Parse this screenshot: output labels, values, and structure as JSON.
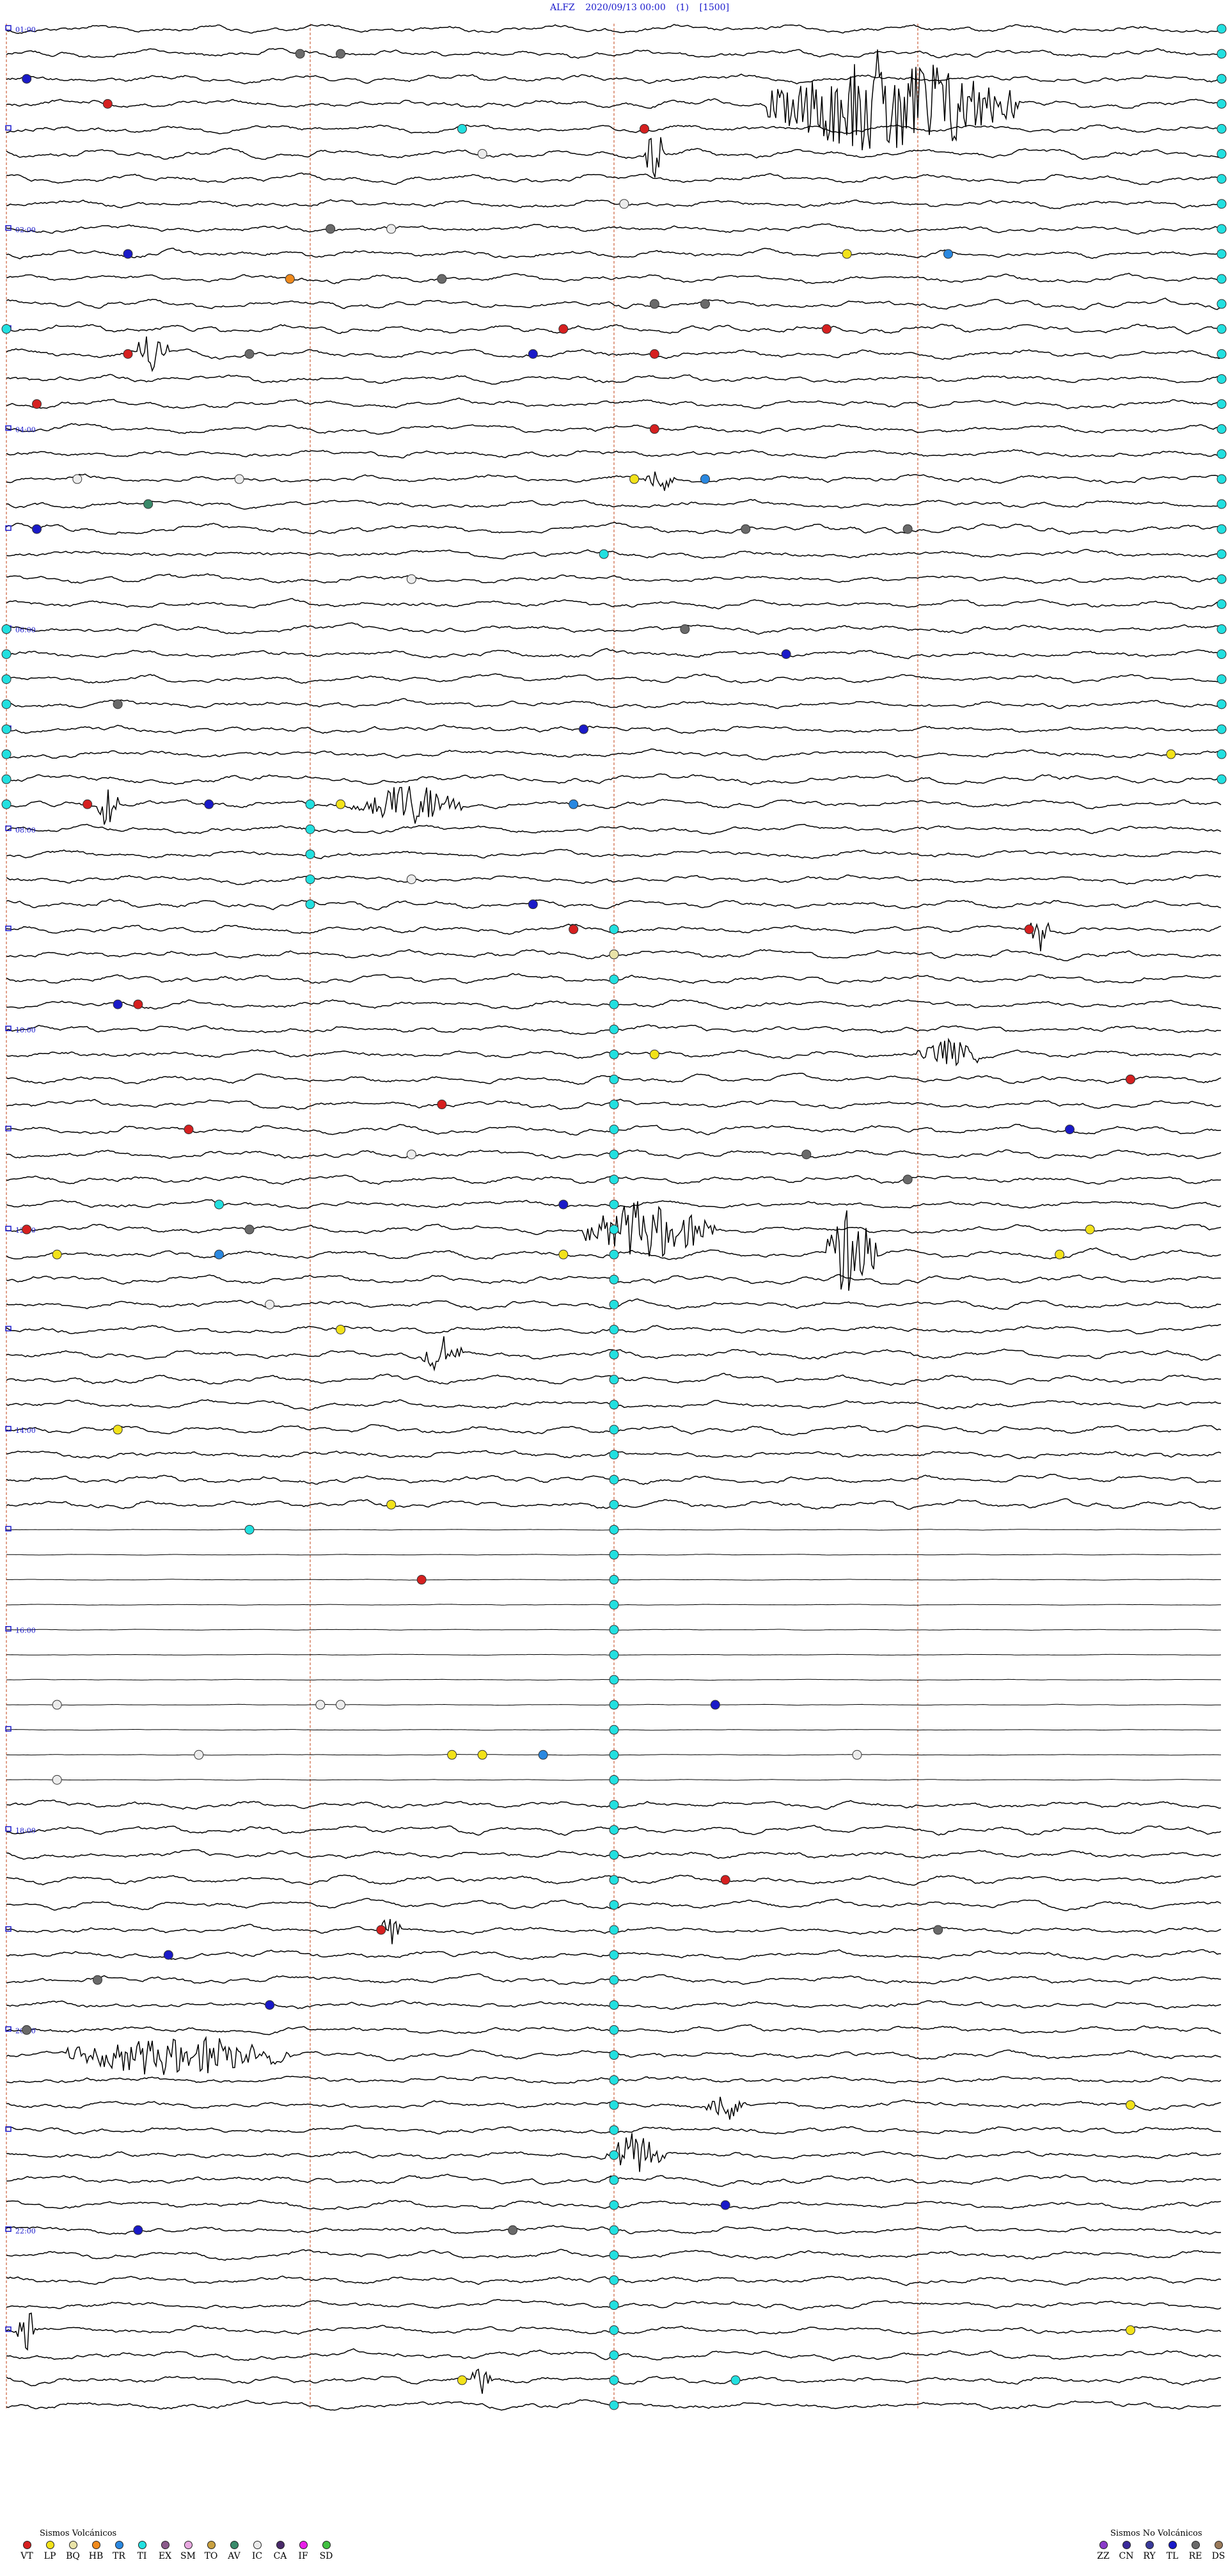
{
  "header": {
    "station": "ALFZ",
    "datetime": "2020/09/13 00:00",
    "channel": "(1)",
    "scale": "[1500]"
  },
  "colors": {
    "trace": "#000000",
    "time_label": "#1a1acc",
    "hour_marker": "#e0a08a",
    "VT": "#d62020",
    "LP": "#f2e21a",
    "BQ": "#e9e3a8",
    "HB": "#f08a1c",
    "TR": "#2a88e0",
    "TI": "#22e0e0",
    "EX": "#8a5a8a",
    "SM": "#e8a8e0",
    "TO": "#c8a040",
    "AV": "#3a8a6a",
    "IC": "#ececec",
    "CA": "#4a2a6a",
    "IF": "#e820e8",
    "SD": "#40c040",
    "ZZ": "#8a3ac8",
    "CN": "#3a2a9a",
    "RY": "#3a3a9a",
    "TL": "#1a1ac8",
    "RE": "#6a6a6a",
    "DS": "#9a7a5a"
  },
  "chart_data": {
    "type": "helicorder",
    "rows_per_hour": 4,
    "hours": 24,
    "minute_markers": [
      15,
      30,
      45
    ],
    "time_labels": [
      "01:00",
      "02:00",
      "04:00",
      "06:00",
      "08:00",
      "10:00",
      "12:00",
      "14:00",
      "16:00",
      "18:00",
      "20:00",
      "22:00"
    ],
    "time_label_rows": [
      0,
      8,
      16,
      24,
      32,
      40,
      48,
      56,
      64,
      72,
      80,
      88
    ],
    "quiet_rows": [
      60,
      70
    ],
    "events": [
      {
        "row": 2,
        "minute": 60,
        "type": "TI"
      },
      {
        "row": 2,
        "minute": 1,
        "type": "TL"
      },
      {
        "row": 1,
        "minute": 14.5,
        "type": "RE"
      },
      {
        "row": 1,
        "minute": 16.5,
        "type": "RE"
      },
      {
        "row": 3,
        "minute": 5,
        "type": "VT"
      },
      {
        "row": 4,
        "minute": 31.5,
        "type": "VT"
      },
      {
        "row": 4,
        "minute": 22.5,
        "type": "TI"
      },
      {
        "row": 5,
        "minute": 23.5,
        "type": "IC"
      },
      {
        "row": 7,
        "minute": 30.5,
        "type": "IC"
      },
      {
        "row": 8,
        "minute": 16,
        "type": "RE"
      },
      {
        "row": 8,
        "minute": 19,
        "type": "IC"
      },
      {
        "row": 9,
        "minute": 6,
        "type": "TL"
      },
      {
        "row": 9,
        "minute": 41.5,
        "type": "LP"
      },
      {
        "row": 9,
        "minute": 46.5,
        "type": "TR"
      },
      {
        "row": 10,
        "minute": 14,
        "type": "HB"
      },
      {
        "row": 10,
        "minute": 21.5,
        "type": "RE"
      },
      {
        "row": 11,
        "minute": 32,
        "type": "RE"
      },
      {
        "row": 11,
        "minute": 34.5,
        "type": "RE"
      },
      {
        "row": 12,
        "minute": 0,
        "type": "TI"
      },
      {
        "row": 12,
        "minute": 27.5,
        "type": "VT"
      },
      {
        "row": 12,
        "minute": 40.5,
        "type": "VT"
      },
      {
        "row": 13,
        "minute": 6,
        "type": "VT"
      },
      {
        "row": 13,
        "minute": 12,
        "type": "RE"
      },
      {
        "row": 13,
        "minute": 26,
        "type": "TL"
      },
      {
        "row": 13,
        "minute": 32,
        "type": "VT"
      },
      {
        "row": 15,
        "minute": 1.5,
        "type": "VT"
      },
      {
        "row": 16,
        "minute": 32,
        "type": "VT"
      },
      {
        "row": 18,
        "minute": 3.5,
        "type": "IC"
      },
      {
        "row": 18,
        "minute": 11.5,
        "type": "IC"
      },
      {
        "row": 18,
        "minute": 31,
        "type": "LP"
      },
      {
        "row": 18,
        "minute": 34.5,
        "type": "TR"
      },
      {
        "row": 19,
        "minute": 7,
        "type": "AV"
      },
      {
        "row": 20,
        "minute": 1.5,
        "type": "TL"
      },
      {
        "row": 20,
        "minute": 36.5,
        "type": "RE"
      },
      {
        "row": 20,
        "minute": 44.5,
        "type": "RE"
      },
      {
        "row": 21,
        "minute": 29.5,
        "type": "TI"
      },
      {
        "row": 22,
        "minute": 20,
        "type": "IC"
      },
      {
        "row": 24,
        "minute": 0,
        "type": "TI"
      },
      {
        "row": 24,
        "minute": 33.5,
        "type": "RE"
      },
      {
        "row": 25,
        "minute": 38.5,
        "type": "TL"
      },
      {
        "row": 27,
        "minute": 60,
        "type": "TI"
      },
      {
        "row": 27,
        "minute": 5.5,
        "type": "RE"
      },
      {
        "row": 28,
        "minute": 28.5,
        "type": "TL"
      },
      {
        "row": 29,
        "minute": 57.5,
        "type": "LP"
      },
      {
        "row": 31,
        "minute": 4,
        "type": "VT"
      },
      {
        "row": 31,
        "minute": 10,
        "type": "TL"
      },
      {
        "row": 31,
        "minute": 16.5,
        "type": "LP"
      },
      {
        "row": 31,
        "minute": 28,
        "type": "TR"
      },
      {
        "row": 34,
        "minute": 20,
        "type": "IC"
      },
      {
        "row": 35,
        "minute": 26,
        "type": "TL"
      },
      {
        "row": 36,
        "minute": 28,
        "type": "VT"
      },
      {
        "row": 36,
        "minute": 50.5,
        "type": "VT"
      },
      {
        "row": 37,
        "minute": 30,
        "type": "BQ"
      },
      {
        "row": 39,
        "minute": 5.5,
        "type": "TL"
      },
      {
        "row": 39,
        "minute": 6.5,
        "type": "VT"
      },
      {
        "row": 41,
        "minute": 32,
        "type": "LP"
      },
      {
        "row": 42,
        "minute": 55.5,
        "type": "RE"
      },
      {
        "row": 42,
        "minute": 55.5,
        "type": "VT"
      },
      {
        "row": 43,
        "minute": 21.5,
        "type": "VT"
      },
      {
        "row": 44,
        "minute": 9,
        "type": "VT"
      },
      {
        "row": 44,
        "minute": 52.5,
        "type": "TL"
      },
      {
        "row": 45,
        "minute": 20,
        "type": "IC"
      },
      {
        "row": 45,
        "minute": 39.5,
        "type": "RE"
      },
      {
        "row": 46,
        "minute": 44.5,
        "type": "RE"
      },
      {
        "row": 47,
        "minute": 10.5,
        "type": "TI"
      },
      {
        "row": 47,
        "minute": 27.5,
        "type": "TL"
      },
      {
        "row": 48,
        "minute": 12,
        "type": "RE"
      },
      {
        "row": 48,
        "minute": 1,
        "type": "VT"
      },
      {
        "row": 48,
        "minute": 53.5,
        "type": "LP"
      },
      {
        "row": 49,
        "minute": 2.5,
        "type": "LP"
      },
      {
        "row": 49,
        "minute": 52,
        "type": "LP"
      },
      {
        "row": 49,
        "minute": 10.5,
        "type": "TR"
      },
      {
        "row": 49,
        "minute": 27.5,
        "type": "LP"
      },
      {
        "row": 51,
        "minute": 13,
        "type": "IC"
      },
      {
        "row": 52,
        "minute": 16.5,
        "type": "LP"
      },
      {
        "row": 56,
        "minute": 5.5,
        "type": "LP"
      },
      {
        "row": 59,
        "minute": 19,
        "type": "LP"
      },
      {
        "row": 60,
        "minute": 12,
        "type": "TI"
      },
      {
        "row": 62,
        "minute": 20.5,
        "type": "VT"
      },
      {
        "row": 67,
        "minute": 2.5,
        "type": "IC"
      },
      {
        "row": 67,
        "minute": 15.5,
        "type": "IC"
      },
      {
        "row": 67,
        "minute": 16.5,
        "type": "IC"
      },
      {
        "row": 67,
        "minute": 35,
        "type": "TL"
      },
      {
        "row": 69,
        "minute": 22,
        "type": "LP"
      },
      {
        "row": 69,
        "minute": 23.5,
        "type": "LP"
      },
      {
        "row": 69,
        "minute": 26.5,
        "type": "TR"
      },
      {
        "row": 69,
        "minute": 9.5,
        "type": "IC"
      },
      {
        "row": 70,
        "minute": 2.5,
        "type": "IC"
      },
      {
        "row": 69,
        "minute": 42,
        "type": "IC"
      },
      {
        "row": 74,
        "minute": 35.5,
        "type": "VT"
      },
      {
        "row": 76,
        "minute": 18.5,
        "type": "VT"
      },
      {
        "row": 76,
        "minute": 46,
        "type": "RE"
      },
      {
        "row": 77,
        "minute": 8,
        "type": "TL"
      },
      {
        "row": 78,
        "minute": 4.5,
        "type": "RE"
      },
      {
        "row": 79,
        "minute": 13,
        "type": "TL"
      },
      {
        "row": 80,
        "minute": 1,
        "type": "RE"
      },
      {
        "row": 83,
        "minute": 55.5,
        "type": "LP"
      },
      {
        "row": 87,
        "minute": 35.5,
        "type": "TL"
      },
      {
        "row": 88,
        "minute": 6.5,
        "type": "TL"
      },
      {
        "row": 88,
        "minute": 25,
        "type": "RE"
      },
      {
        "row": 92,
        "minute": 55.5,
        "type": "LP"
      },
      {
        "row": 94,
        "minute": 22.5,
        "type": "LP"
      },
      {
        "row": 94,
        "minute": 36,
        "type": "TI"
      }
    ],
    "event_bursts": [
      {
        "row": 3,
        "start": 37.5,
        "end": 50,
        "amp": 2.2
      },
      {
        "row": 5,
        "start": 31.5,
        "end": 32.5,
        "amp": 1.4
      },
      {
        "row": 13,
        "start": 6.5,
        "end": 8,
        "amp": 1.0
      },
      {
        "row": 18,
        "start": 31.5,
        "end": 33,
        "amp": 0.6
      },
      {
        "row": 31,
        "start": 4.5,
        "end": 5.5,
        "amp": 0.9
      },
      {
        "row": 31,
        "start": 17,
        "end": 22.5,
        "amp": 0.9
      },
      {
        "row": 36,
        "start": 50.5,
        "end": 51.5,
        "amp": 0.9
      },
      {
        "row": 41,
        "start": 45,
        "end": 48,
        "amp": 0.6
      },
      {
        "row": 48,
        "start": 28.5,
        "end": 35,
        "amp": 1.2
      },
      {
        "row": 49,
        "start": 40.5,
        "end": 43,
        "amp": 2.0
      },
      {
        "row": 53,
        "start": 20.5,
        "end": 22.5,
        "amp": 0.7
      },
      {
        "row": 76,
        "start": 18.5,
        "end": 19.5,
        "amp": 0.7
      },
      {
        "row": 81,
        "start": 3,
        "end": 14,
        "amp": 0.8
      },
      {
        "row": 83,
        "start": 34.5,
        "end": 36.5,
        "amp": 0.7
      },
      {
        "row": 85,
        "start": 29.5,
        "end": 32.5,
        "amp": 0.9
      },
      {
        "row": 92,
        "start": 0.5,
        "end": 1.5,
        "amp": 1.0
      },
      {
        "row": 94,
        "start": 23,
        "end": 24,
        "amp": 0.8
      }
    ],
    "ti_columns": [
      {
        "minute": 60,
        "from_row": 0,
        "to_row": 30
      },
      {
        "minute": 30,
        "from_row": 36,
        "to_row": 95
      },
      {
        "minute": 15,
        "from_row": 31,
        "to_row": 35
      },
      {
        "minute": 0,
        "from_row": 25,
        "to_row": 31
      }
    ]
  },
  "legend": {
    "volcanic": {
      "title": "Sismos Volcánicos",
      "items": [
        {
          "code": "VT",
          "color": "#d62020"
        },
        {
          "code": "LP",
          "color": "#f2e21a"
        },
        {
          "code": "BQ",
          "color": "#e9e3a8"
        },
        {
          "code": "HB",
          "color": "#f08a1c"
        },
        {
          "code": "TR",
          "color": "#2a88e0"
        },
        {
          "code": "TI",
          "color": "#22e0e0"
        },
        {
          "code": "EX",
          "color": "#8a5a8a"
        },
        {
          "code": "SM",
          "color": "#e8a8e0"
        },
        {
          "code": "TO",
          "color": "#c8a040"
        },
        {
          "code": "AV",
          "color": "#3a8a6a"
        },
        {
          "code": "IC",
          "color": "#ececec"
        },
        {
          "code": "CA",
          "color": "#4a2a6a"
        },
        {
          "code": "IF",
          "color": "#e820e8"
        },
        {
          "code": "SD",
          "color": "#40c040"
        }
      ]
    },
    "non_volcanic": {
      "title": "Sismos No Volcánicos",
      "items": [
        {
          "code": "ZZ",
          "color": "#8a3ac8"
        },
        {
          "code": "CN",
          "color": "#3a2a9a"
        },
        {
          "code": "RY",
          "color": "#3a3a9a"
        },
        {
          "code": "TL",
          "color": "#1a1ac8"
        },
        {
          "code": "RE",
          "color": "#6a6a6a"
        },
        {
          "code": "DS",
          "color": "#9a7a5a"
        }
      ]
    }
  }
}
